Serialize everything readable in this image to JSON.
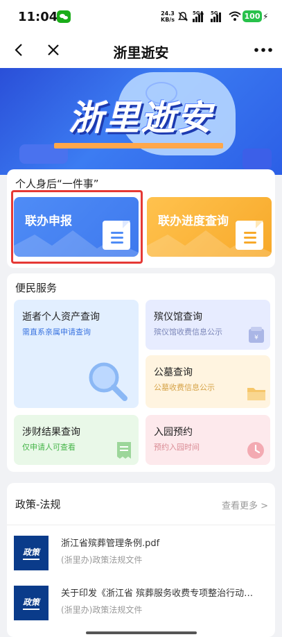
{
  "status_bar": {
    "time": "11:04",
    "net_speed": "24.3",
    "net_unit": "KB/s",
    "sim1_label": "5GA",
    "sim2_label": "5G",
    "battery": "100"
  },
  "title_bar": {
    "title": "浙里逝安"
  },
  "banner": {
    "title": "浙里逝安"
  },
  "life_matters": {
    "title": "个人身后“一件事”",
    "apply_label": "联办申报",
    "progress_label": "联办进度查询"
  },
  "services": {
    "title": "便民服务",
    "items": [
      {
        "title": "逝者个人资产查询",
        "sub": "需直系亲属申请查询"
      },
      {
        "title": "殡仪馆查询",
        "sub": "殡仪馆收费信息公示"
      },
      {
        "title": "公墓查询",
        "sub": "公墓收费信息公示"
      },
      {
        "title": "涉财结果查询",
        "sub": "仅申请人可查看"
      },
      {
        "title": "入园预约",
        "sub": "预约入园时间"
      }
    ]
  },
  "policy": {
    "title": "政策-法规",
    "view_more": "查看更多 >",
    "badge": "政策",
    "items": [
      {
        "name": "浙江省殡葬管理条例.pdf",
        "source": "(浙里办)政策法规文件"
      },
      {
        "name": "关于印发《浙江省 殡葬服务收费专项整治行动…",
        "source": "(浙里办)政策法规文件"
      }
    ]
  },
  "colors": {
    "brand_blue": "#3e79ee",
    "orange": "#f7a92a",
    "highlight_red": "#e53935",
    "policy_badge": "#0a3b8a"
  }
}
